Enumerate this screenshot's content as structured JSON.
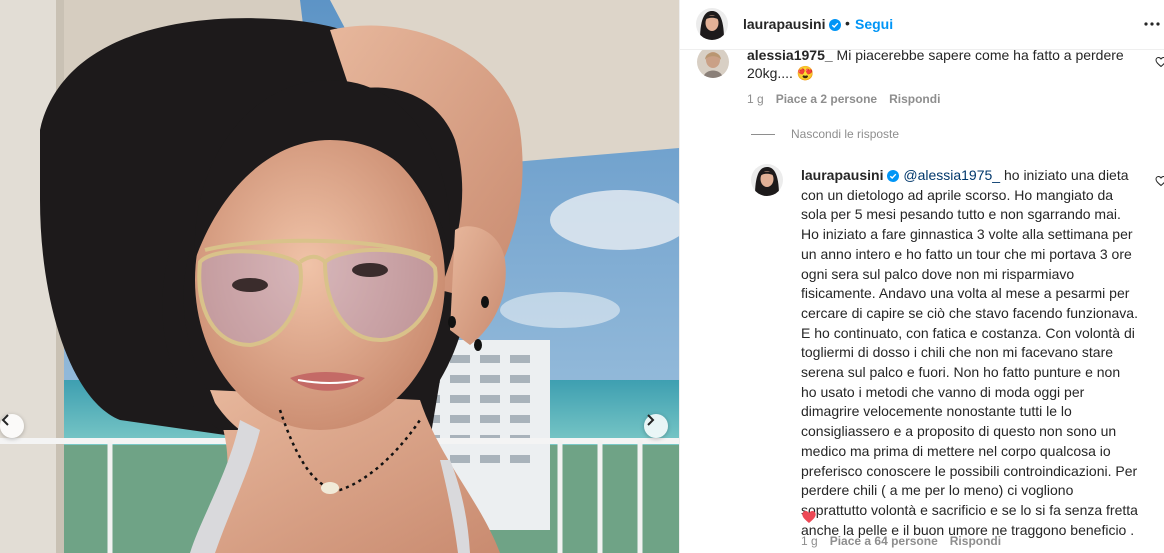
{
  "post_header": {
    "username": "laurapausini",
    "dot": "•",
    "follow_label": "Segui",
    "more_icon": "more-horizontal-icon"
  },
  "comments": [
    {
      "username": "alessia1975_",
      "text": "Mi piacerebbe sapere come ha fatto a perdere 20kg....",
      "emoji": "😍",
      "time": "1 g",
      "likes": "Piace a 2 persone",
      "reply_label": "Rispondi"
    }
  ],
  "hide_replies_label": "Nascondi le risposte",
  "reply": {
    "username": "laurapausini",
    "mention": "@alessia1975_",
    "text": "ho iniziato una dieta con un dietologo ad aprile scorso. Ho mangiato da sola per 5 mesi pesando tutto e non sgarrando mai. Ho iniziato a fare ginnastica 3 volte alla settimana per un anno intero e ho fatto un tour che mi portava 3 ore ogni sera sul palco dove non mi risparmiavo fisicamente. Andavo una volta al mese a pesarmi per cercare di capire se ciò che stavo facendo funzionava. E ho continuato, con fatica e costanza. Con volontà di togliermi di dosso i chili che non mi facevano stare serena sul palco e fuori. Non ho fatto punture e non ho usato i metodi che vanno di moda oggi per dimagrire velocemente nonostante tutti le lo consigliassero e a proposito di questo non sono un medico ma prima di mettere nel corpo qualcosa io preferisco conoscere le possibili controindicazioni. Per perdere chili ( a me per lo meno) ci vogliono soprattutto volontà e sacrificio e se lo si fa senza fretta anche la pelle e il buon umore ne traggono beneficio .",
    "emoji": "❤️",
    "time": "1 g",
    "likes": "Piace a 64 persone",
    "reply_label": "Rispondi"
  },
  "colors": {
    "link_blue": "#0095f6",
    "mention_blue": "#00376b",
    "muted": "#8e8e8e",
    "verified_blue": "#0095f6"
  }
}
